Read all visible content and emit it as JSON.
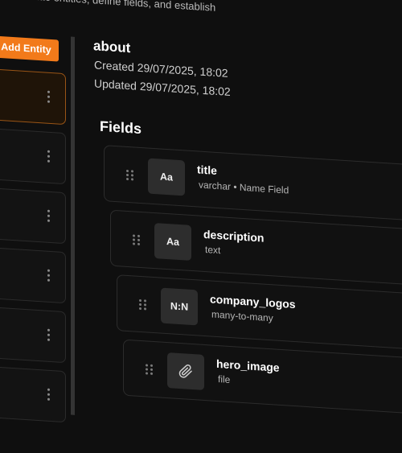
{
  "header": {
    "subtitle": "ure. Create entities, define fields, and establish"
  },
  "sidebar": {
    "add_entity_label": "Add Entity",
    "entities": [
      {
        "active": true
      },
      {
        "active": false
      },
      {
        "active": false
      },
      {
        "active": false
      },
      {
        "active": false
      },
      {
        "active": false
      }
    ]
  },
  "entity": {
    "name": "about",
    "created": "Created 29/07/2025, 18:02",
    "updated": "Updated 29/07/2025, 18:02"
  },
  "fields": {
    "heading": "Fields",
    "items": [
      {
        "badge": "Aa",
        "name": "title",
        "type": "varchar • Name Field",
        "icon": "text-type-icon"
      },
      {
        "badge": "Aa",
        "name": "description",
        "type": "text",
        "icon": "text-type-icon"
      },
      {
        "badge": "N:N",
        "name": "company_logos",
        "type": "many-to-many",
        "icon": "relation-type-icon"
      },
      {
        "badge": "",
        "name": "hero_image",
        "type": "file",
        "icon": "paperclip-icon"
      }
    ]
  },
  "colors": {
    "accent": "#f27a1a",
    "background": "#0f0f0f",
    "card_border": "#2c2c2c"
  }
}
